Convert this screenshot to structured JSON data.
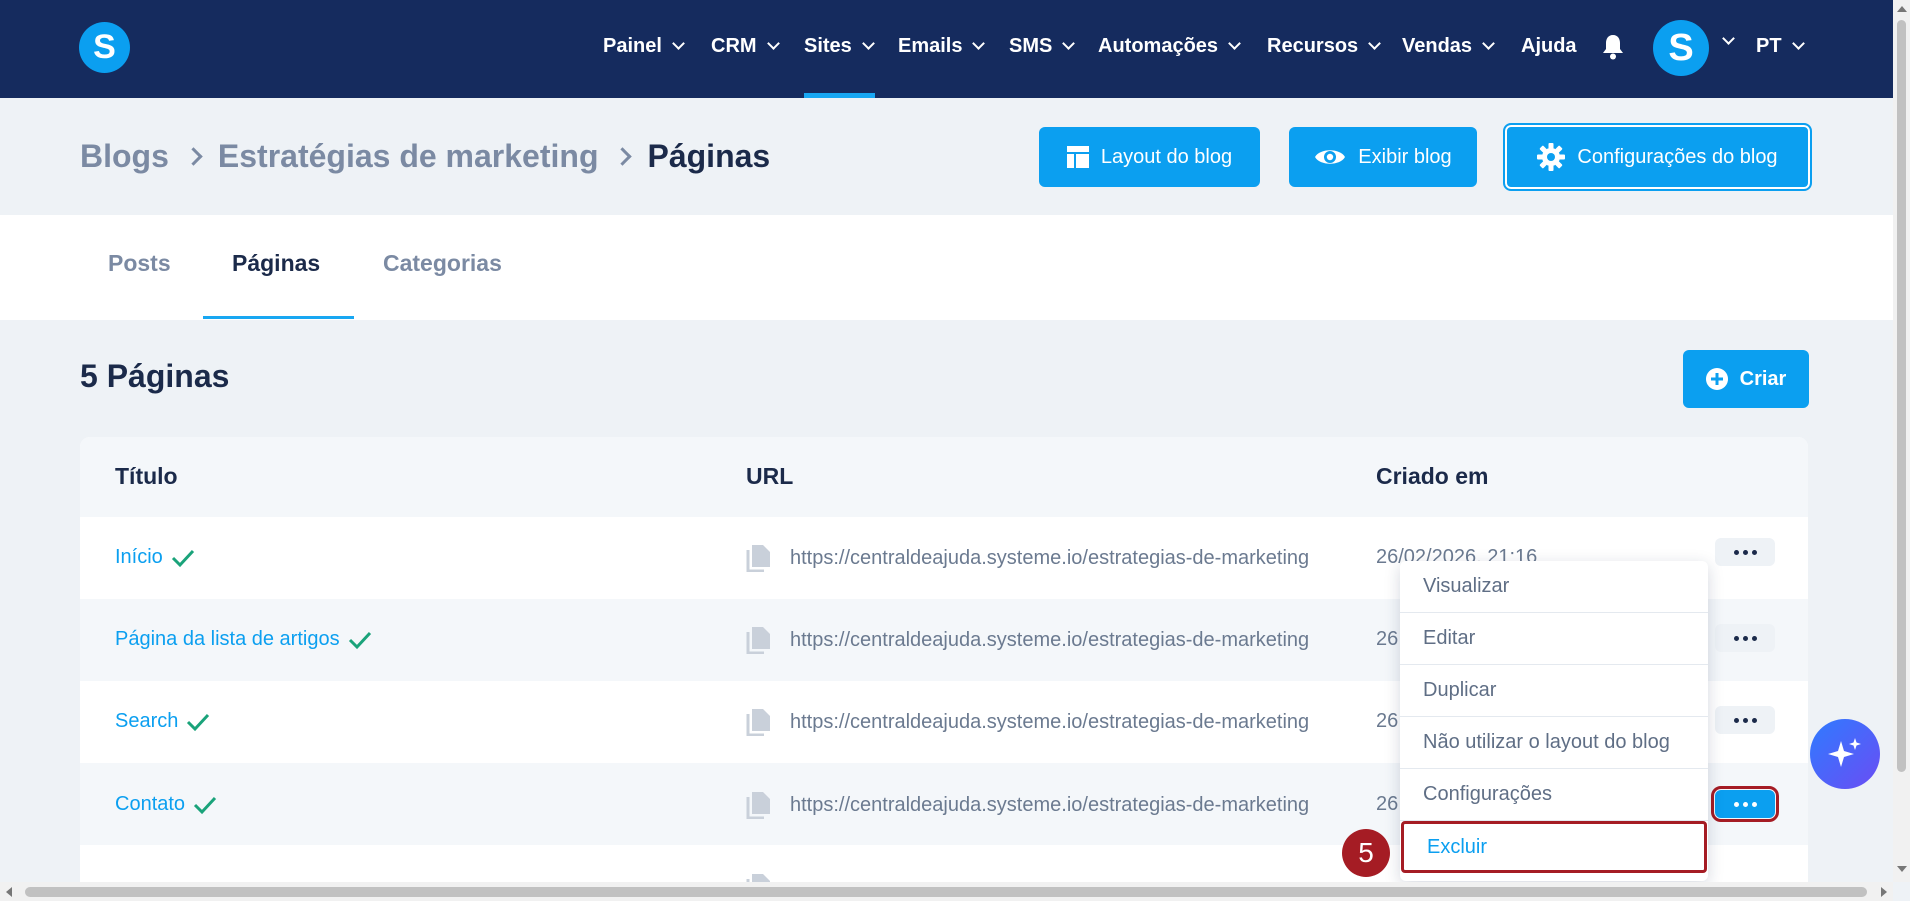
{
  "nav": {
    "logo": "S",
    "items": [
      {
        "label": "Painel"
      },
      {
        "label": "CRM"
      },
      {
        "label": "Sites"
      },
      {
        "label": "Emails"
      },
      {
        "label": "SMS"
      },
      {
        "label": "Automações"
      },
      {
        "label": "Recursos"
      },
      {
        "label": "Vendas"
      },
      {
        "label": "Ajuda"
      }
    ],
    "active_item": "Sites",
    "avatar_letter": "S",
    "language": "PT"
  },
  "breadcrumb": {
    "items": [
      "Blogs",
      "Estratégias de marketing"
    ],
    "current": "Páginas"
  },
  "actions": {
    "layout_label": "Layout do blog",
    "view_label": "Exibir blog",
    "settings_label": "Configurações do blog"
  },
  "tabs": [
    {
      "label": "Posts"
    },
    {
      "label": "Páginas"
    },
    {
      "label": "Categorias"
    }
  ],
  "active_tab": "Páginas",
  "content": {
    "count_title": "5 Páginas",
    "create_label": "Criar"
  },
  "table": {
    "columns": [
      "Título",
      "URL",
      "Criado em"
    ],
    "rows": [
      {
        "title": "Início",
        "url": "https://centraldeajuda.systeme.io/estrategias-de-marketing",
        "date": "26/02/2026, 21:16"
      },
      {
        "title": "Página da lista de artigos",
        "url": "https://centraldeajuda.systeme.io/estrategias-de-marketing",
        "date": "26,"
      },
      {
        "title": "Search",
        "url": "https://centraldeajuda.systeme.io/estrategias-de-marketing",
        "date": "26,"
      },
      {
        "title": "Contato",
        "url": "https://centraldeajuda.systeme.io/estrategias-de-marketing",
        "date": "26,"
      }
    ]
  },
  "menu": {
    "items": [
      "Visualizar",
      "Editar",
      "Duplicar",
      "Não utilizar o layout do blog",
      "Configurações",
      "Excluir"
    ]
  },
  "step_badge": "5",
  "colors": {
    "nav_bg": "#152b5e",
    "accent": "#0b9ff0",
    "highlight": "#a51c24",
    "check": "#1aa37a"
  }
}
